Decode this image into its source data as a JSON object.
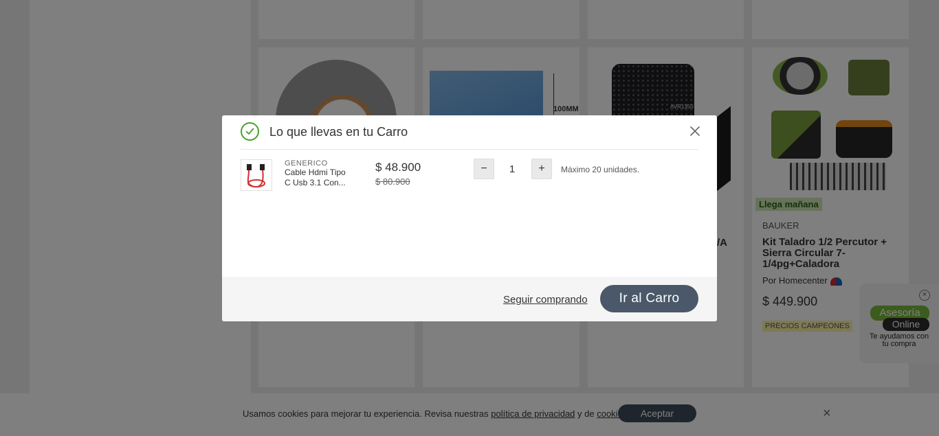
{
  "background": {
    "product_card_sheet_label": "100MM",
    "product_card_device_brand": "AVR1350",
    "partial_title_fragment": "/A",
    "featured_product": {
      "badge": "Llega mañana",
      "brand": "BAUKER",
      "title": "Kit Taladro 1/2 Percutor + Sierra Circular 7-1/4pg+Caladora",
      "seller": "Por Homecenter",
      "price": "$ 449.900",
      "promo": "PRECIOS CAMPEONES"
    }
  },
  "chat_widget": {
    "close_symbol": "×",
    "bubble_line1": "Asesoría",
    "bubble_line2": "Online",
    "caption": "Te ayudamos con tu compra"
  },
  "cookie_bar": {
    "text_before": "Usamos cookies para mejorar tu experiencia. Revisa nuestras ",
    "privacy_link": "política de privacidad",
    "text_middle": " y de ",
    "cookies_link": "cookies",
    "text_after": ".",
    "accept_label": "Aceptar",
    "close_symbol": "×"
  },
  "modal": {
    "title": "Lo que llevas en tu Carro",
    "item": {
      "brand": "GENERICO",
      "name": "Cable Hdmi Tipo C Usb 3.1 Con...",
      "price": "$ 48.900",
      "old_price": "$ 80.900",
      "quantity": "1",
      "minus_symbol": "−",
      "plus_symbol": "+",
      "max_note": "Máximo 20 unidades."
    },
    "footer": {
      "continue_label": "Seguir comprando",
      "cart_label": "Ir al Carro"
    }
  },
  "colors": {
    "success_green": "#46a12b",
    "primary_button": "#4a5869"
  },
  "icons": [
    "check-circle-icon",
    "close-icon",
    "chat-close-icon",
    "cookie-close-icon",
    "homecenter-store-icon"
  ]
}
